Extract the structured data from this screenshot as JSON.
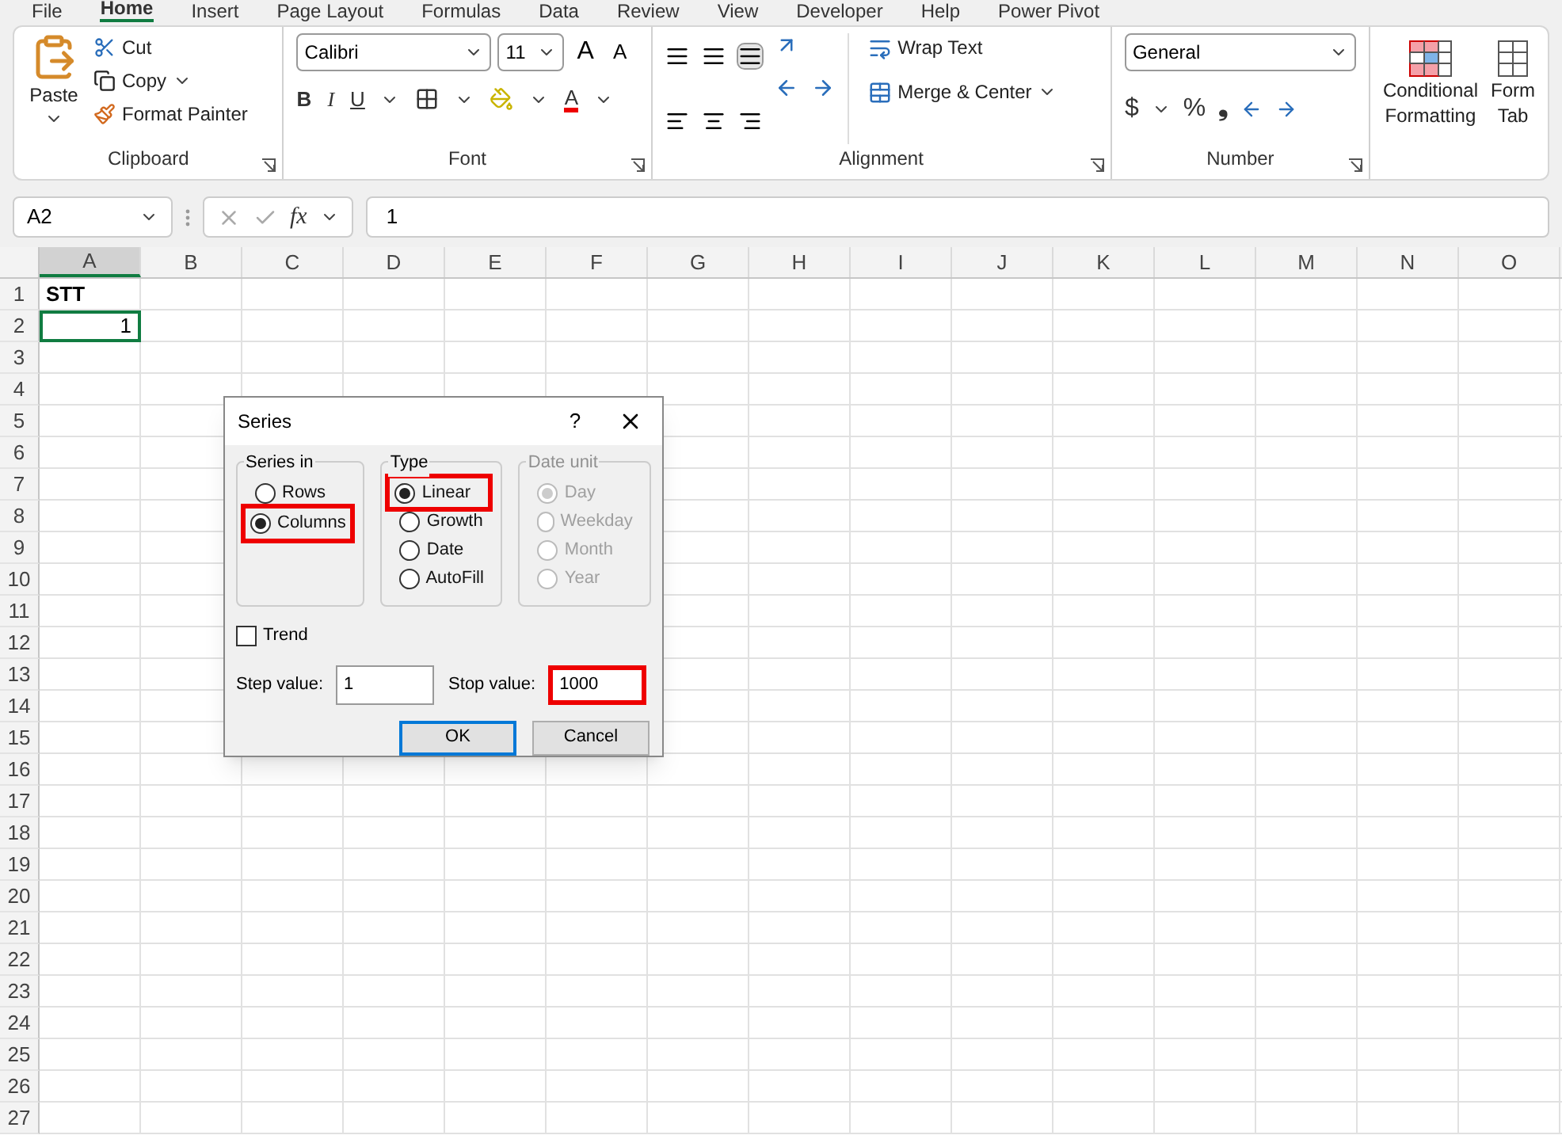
{
  "ribbon_tabs": [
    {
      "label": "File",
      "selected": false
    },
    {
      "label": "Home",
      "selected": true
    },
    {
      "label": "Insert",
      "selected": false
    },
    {
      "label": "Page Layout",
      "selected": false
    },
    {
      "label": "Formulas",
      "selected": false
    },
    {
      "label": "Data",
      "selected": false
    },
    {
      "label": "Review",
      "selected": false
    },
    {
      "label": "View",
      "selected": false
    },
    {
      "label": "Developer",
      "selected": false
    },
    {
      "label": "Help",
      "selected": false
    },
    {
      "label": "Power Pivot",
      "selected": false
    }
  ],
  "clipboard": {
    "paste": "Paste",
    "cut": "Cut",
    "copy": "Copy",
    "format_painter": "Format Painter",
    "group": "Clipboard"
  },
  "font": {
    "name": "Calibri",
    "size": "11",
    "grow": "A",
    "shrink": "A",
    "bold": "B",
    "italic": "I",
    "underline": "U",
    "font_color": "A",
    "group": "Font"
  },
  "alignment": {
    "wrap_text": "Wrap Text",
    "merge": "Merge & Center",
    "group": "Alignment"
  },
  "number": {
    "format": "General",
    "currency": "$",
    "percent": "%",
    "comma": "❟",
    "group": "Number"
  },
  "styles": {
    "conditional_formatting": [
      "Conditional",
      "Formatting"
    ],
    "format_table": [
      "Form",
      "Tab"
    ]
  },
  "formula_bar": {
    "name_box": "A2",
    "fx": "fx",
    "value": "1"
  },
  "sheet": {
    "columns": [
      "A",
      "B",
      "C",
      "D",
      "E",
      "F",
      "G",
      "H",
      "I",
      "J",
      "K",
      "L",
      "M",
      "N",
      "O"
    ],
    "rows": [
      {
        "number": "1",
        "cells": [
          {
            "text": "STT",
            "kind": "header",
            "selected": false
          }
        ]
      },
      {
        "number": "2",
        "cells": [
          {
            "text": "1",
            "kind": "number",
            "selected": true
          }
        ]
      },
      {
        "number": "3"
      },
      {
        "number": "4"
      },
      {
        "number": "5"
      },
      {
        "number": "6"
      },
      {
        "number": "7"
      },
      {
        "number": "8"
      },
      {
        "number": "9"
      },
      {
        "number": "10"
      },
      {
        "number": "11"
      },
      {
        "number": "12"
      },
      {
        "number": "13"
      },
      {
        "number": "14"
      },
      {
        "number": "15"
      },
      {
        "number": "16"
      },
      {
        "number": "17"
      },
      {
        "number": "18"
      },
      {
        "number": "19"
      },
      {
        "number": "20"
      },
      {
        "number": "21"
      },
      {
        "number": "22"
      },
      {
        "number": "23"
      },
      {
        "number": "24"
      },
      {
        "number": "25"
      },
      {
        "number": "26"
      },
      {
        "number": "27"
      }
    ]
  },
  "dialog": {
    "title": "Series",
    "help": "?",
    "groups": [
      {
        "label": "Series in",
        "disabled": false,
        "options": [
          {
            "label": "Rows",
            "selected": false,
            "highlighted": false
          },
          {
            "label": "Columns",
            "selected": true,
            "highlighted": true
          }
        ]
      },
      {
        "label": "Type",
        "disabled": false,
        "options": [
          {
            "label": "Linear",
            "selected": true,
            "highlighted": true
          },
          {
            "label": "Growth",
            "selected": false,
            "highlighted": false
          },
          {
            "label": "Date",
            "selected": false,
            "highlighted": false
          },
          {
            "label": "AutoFill",
            "selected": false,
            "highlighted": false
          }
        ]
      },
      {
        "label": "Date unit",
        "disabled": true,
        "options": [
          {
            "label": "Day",
            "selected": true,
            "highlighted": false
          },
          {
            "label": "Weekday",
            "selected": false,
            "highlighted": false
          },
          {
            "label": "Month",
            "selected": false,
            "highlighted": false
          },
          {
            "label": "Year",
            "selected": false,
            "highlighted": false
          }
        ]
      }
    ],
    "trend": {
      "label": "Trend",
      "checked": false
    },
    "step": {
      "label": "Step value:",
      "value": "1",
      "highlighted": false
    },
    "stop": {
      "label": "Stop value:",
      "value": "1000",
      "highlighted": true
    },
    "buttons": [
      {
        "label": "OK",
        "default": true
      },
      {
        "label": "Cancel",
        "default": false
      }
    ]
  }
}
